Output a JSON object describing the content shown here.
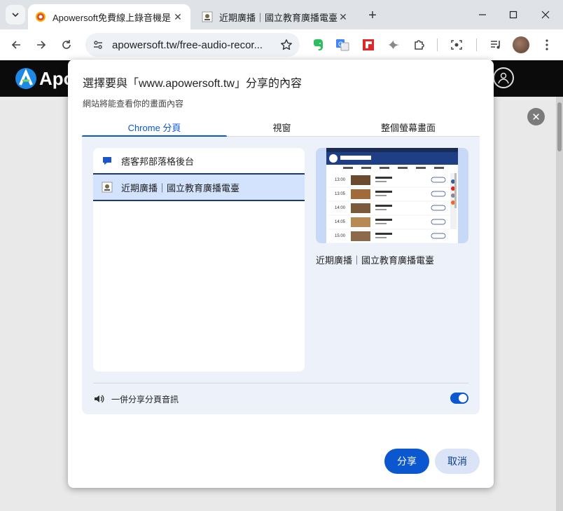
{
  "browser": {
    "tabs": [
      {
        "title": "Apowersoft免費線上錄音機是",
        "active": true
      },
      {
        "title": "近期廣播｜國立教育廣播電臺",
        "active": false
      }
    ],
    "url": "apowersoft.tw/free-audio-recor...",
    "new_tab_glyph": "+"
  },
  "site": {
    "logo_text": "Apo",
    "overlay_close_glyph": "✕"
  },
  "dialog": {
    "title": "選擇要與「www.apowersoft.tw」分享的內容",
    "subtitle": "網站將能查看你的畫面內容",
    "tabs": [
      "Chrome 分頁",
      "視窗",
      "整個螢幕畫面"
    ],
    "selected_tab": 0,
    "items": [
      {
        "label": "痞客邦部落格後台",
        "selected": false
      },
      {
        "label": "近期廣播｜國立教育廣播電臺",
        "selected": true
      }
    ],
    "preview_caption": "近期廣播｜國立教育廣播電臺",
    "audio_label": "一併分享分頁音訊",
    "audio_enabled": true,
    "share_button": "分享",
    "cancel_button": "取消"
  },
  "preview_page": {
    "times": [
      "13:00",
      "13:05",
      "14:00",
      "14:05",
      "15:00"
    ]
  },
  "colors": {
    "accent": "#0b57d0",
    "panel": "#edf1fa",
    "selected_row": "#d3e3fd",
    "site_header": "#0b0b0b"
  }
}
